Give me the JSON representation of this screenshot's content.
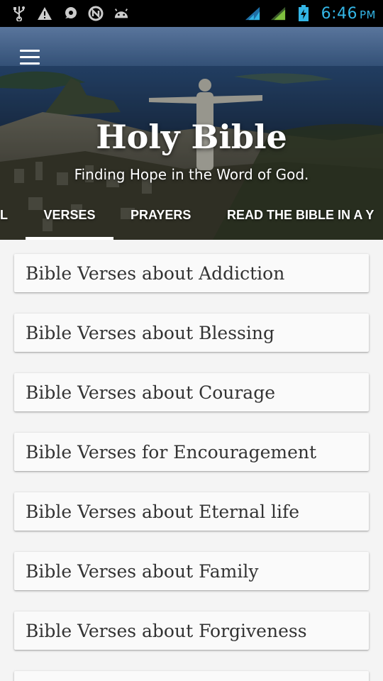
{
  "status_bar": {
    "time": "6:46",
    "ampm": "PM",
    "icons_left": [
      "usb-icon",
      "warning-icon",
      "messenger-icon",
      "n-icon",
      "android-icon"
    ],
    "icons_right": [
      "wifi-signal-icon",
      "cell-signal-icon",
      "battery-charging-icon"
    ],
    "accent": "#33b5e5"
  },
  "header": {
    "title": "Holy Bible",
    "subtitle": "Finding Hope in the Word of God.",
    "menu_icon": "hamburger-menu-icon"
  },
  "tabs": [
    {
      "label": "L",
      "selected": false
    },
    {
      "label": "VERSES",
      "selected": true
    },
    {
      "label": "PRAYERS",
      "selected": false
    },
    {
      "label": "READ THE BIBLE IN A Y",
      "selected": false
    }
  ],
  "list": {
    "items": [
      "Bible Verses about Addiction",
      "Bible Verses about Blessing",
      "Bible Verses about Courage",
      "Bible Verses for Encouragement",
      "Bible Verses about Eternal life",
      "Bible Verses about Family",
      "Bible Verses about Forgiveness"
    ]
  }
}
